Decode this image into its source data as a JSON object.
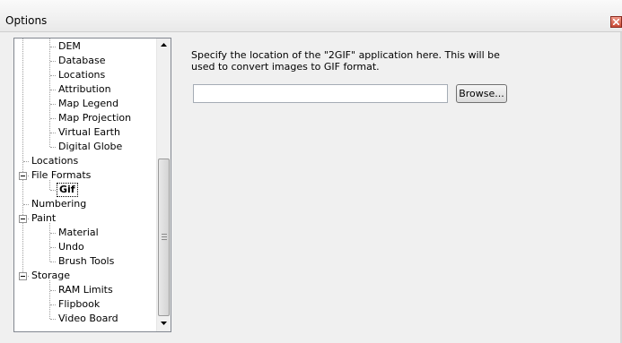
{
  "window": {
    "title": "Options"
  },
  "tree": {
    "items": [
      {
        "label": "DEM",
        "level": 2
      },
      {
        "label": "Database",
        "level": 2
      },
      {
        "label": "Locations",
        "level": 2
      },
      {
        "label": "Attribution",
        "level": 2
      },
      {
        "label": "Map Legend",
        "level": 2
      },
      {
        "label": "Map Projection",
        "level": 2
      },
      {
        "label": "Virtual Earth",
        "level": 2
      },
      {
        "label": "Digital Globe",
        "level": 2
      },
      {
        "label": "Locations",
        "level": 1
      },
      {
        "label": "File Formats",
        "level": 1,
        "expander": "expanded"
      },
      {
        "label": "Gif",
        "level": 2,
        "selected": true
      },
      {
        "label": "Numbering",
        "level": 1
      },
      {
        "label": "Paint",
        "level": 1,
        "expander": "expanded"
      },
      {
        "label": "Material",
        "level": 2
      },
      {
        "label": "Undo",
        "level": 2
      },
      {
        "label": "Brush Tools",
        "level": 2
      },
      {
        "label": "Storage",
        "level": 1,
        "expander": "expanded"
      },
      {
        "label": "RAM Limits",
        "level": 2
      },
      {
        "label": "Flipbook",
        "level": 2
      },
      {
        "label": "Video Board",
        "level": 2
      }
    ]
  },
  "gif_settings": {
    "description": "Specify the location of the \"2GIF\" application here. This will be used to convert images to GIF format.",
    "path_value": "",
    "browse_label": "Browse..."
  },
  "icons": {
    "close": "close-icon",
    "expander": "collapse-icon",
    "scroll_up": "chevron-up-icon",
    "scroll_down": "chevron-down-icon"
  }
}
